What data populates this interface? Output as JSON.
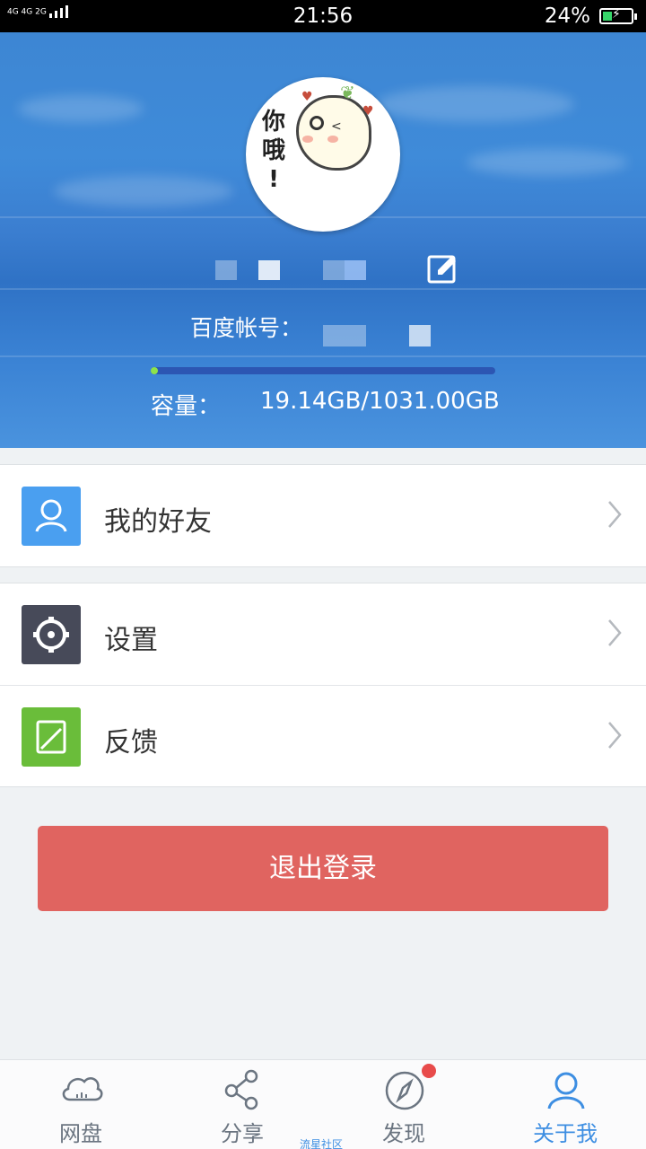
{
  "status_bar": {
    "signal": "4G 4G 2G",
    "time": "21:56",
    "battery": "24%"
  },
  "profile": {
    "account_label": "百度帐号：",
    "capacity_label": "容量：",
    "capacity_value": "19.14GB/1031.00GB",
    "usage_fraction": 0.0186
  },
  "menu": {
    "friends": "我的好友",
    "settings": "设置",
    "feedback": "反馈"
  },
  "logout_label": "退出登录",
  "tabs": [
    {
      "label": "网盘",
      "icon": "cloud-icon"
    },
    {
      "label": "分享",
      "icon": "share-icon"
    },
    {
      "label": "发现",
      "icon": "compass-icon"
    },
    {
      "label": "关于我",
      "icon": "person-icon"
    }
  ],
  "watermark": "流星社区",
  "colors": {
    "accent": "#3d8ee2",
    "logout": "#e06460",
    "friends_icon": "#4a9ff0",
    "settings_icon": "#474a59",
    "feedback_icon": "#6abd3a",
    "badge": "#e84b4b"
  }
}
